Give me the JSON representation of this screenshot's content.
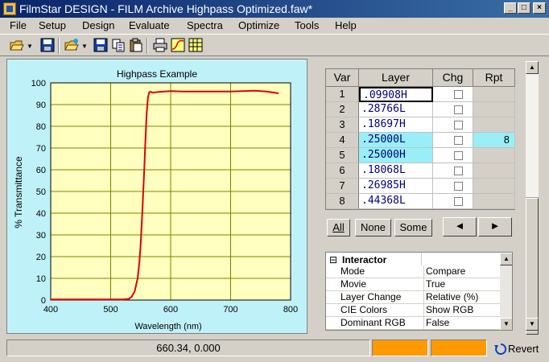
{
  "window": {
    "title": "FilmStar DESIGN - FILM Archive Highpass Optimized.faw*",
    "min_label": "_",
    "max_label": "□",
    "close_label": "×"
  },
  "menu": [
    "File",
    "Setup",
    "Design",
    "Evaluate",
    "Spectra",
    "Optimize",
    "Tools",
    "Help"
  ],
  "toolbar": [
    "open-icon",
    "save-icon",
    "open-icon",
    "save-icon",
    "copy-icon",
    "paste-icon",
    "print-icon",
    "chart-icon",
    "table-icon"
  ],
  "chart_data": {
    "type": "line",
    "title": "Highpass Example",
    "xlabel": "Wavelength (nm)",
    "ylabel": "% Transmittance",
    "xlim": [
      400,
      800
    ],
    "ylim": [
      0,
      100
    ],
    "xticks": [
      400,
      500,
      600,
      700,
      800
    ],
    "yticks": [
      0,
      10,
      20,
      30,
      40,
      50,
      60,
      70,
      80,
      90,
      100
    ],
    "grid": true,
    "background": "#ffffc0",
    "series": [
      {
        "color": "#e00000",
        "x": [
          400,
          480,
          520,
          530,
          535,
          540,
          545,
          548,
          550,
          553,
          556,
          558,
          560,
          562,
          564,
          566,
          570,
          580,
          600,
          620,
          650,
          700,
          740,
          760,
          780
        ],
        "y": [
          0.3,
          0.3,
          0.3,
          0.5,
          1.5,
          4,
          10,
          18,
          26,
          42,
          60,
          74,
          86,
          93,
          95.5,
          96,
          95.5,
          95.8,
          96.2,
          96,
          96,
          96,
          96.4,
          96,
          95.2
        ]
      }
    ]
  },
  "table": {
    "headers": [
      "Var",
      "Layer",
      "Chg",
      "Rpt"
    ],
    "rows": [
      {
        "n": "1",
        "layer": ".09908H",
        "rpt": ""
      },
      {
        "n": "2",
        "layer": ".28766L",
        "rpt": ""
      },
      {
        "n": "3",
        "layer": ".18697H",
        "rpt": ""
      },
      {
        "n": "4",
        "layer": ".25000L",
        "rpt": "8"
      },
      {
        "n": "5",
        "layer": ".25000H",
        "rpt": ""
      },
      {
        "n": "6",
        "layer": ".18068L",
        "rpt": ""
      },
      {
        "n": "7",
        "layer": ".26985H",
        "rpt": ""
      },
      {
        "n": "8",
        "layer": ".44368L",
        "rpt": ""
      }
    ]
  },
  "buttons": {
    "all": "All",
    "none": "None",
    "some": "Some",
    "prev": "◄",
    "next": "►"
  },
  "interactor": {
    "header": "Interactor",
    "collapse": "⊟",
    "props": [
      {
        "name": "Mode",
        "value": "Compare"
      },
      {
        "name": "Movie",
        "value": "True"
      },
      {
        "name": "Layer Change",
        "value": "Relative (%)"
      },
      {
        "name": "CIE Colors",
        "value": "Show RGB"
      },
      {
        "name": "Dominant RGB",
        "value": "False"
      }
    ]
  },
  "status": {
    "coords": "660.34, 0.000",
    "revert": "Revert",
    "indicator_color": "#ff9900"
  }
}
